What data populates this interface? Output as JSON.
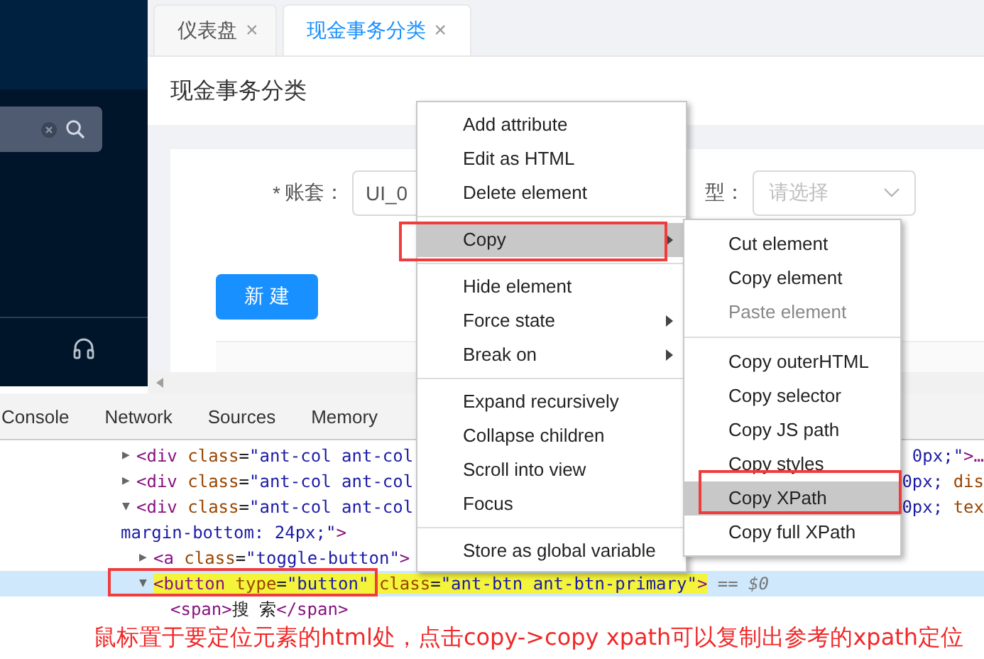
{
  "app": {
    "tabs": [
      {
        "label": "仪表盘",
        "close": "×",
        "selected": false
      },
      {
        "label": "现金事务分类",
        "close": "×",
        "selected": true
      }
    ],
    "page_title": "现金事务分类",
    "form": [
      {
        "required_mark": "*",
        "label": "账套：",
        "value": "UI_0"
      },
      {
        "label": "型：",
        "placeholder": "请选择"
      }
    ],
    "new_button": "新 建"
  },
  "devtools": {
    "tabs": [
      "Console",
      "Network",
      "Sources",
      "Memory"
    ],
    "elements": [
      {
        "toggle": "▶",
        "selected": false,
        "open": [
          {
            "kind": "tag",
            "text": "<div"
          },
          {
            "kind": "attr",
            "text": " class"
          },
          {
            "kind": "plain",
            "text": "="
          },
          {
            "kind": "value",
            "text": "\"ant-col ant-col"
          }
        ],
        "right": [
          {
            "kind": "value",
            "text": "0px;\""
          },
          {
            "kind": "tag",
            "text": ">…"
          }
        ]
      },
      {
        "toggle": "▶",
        "selected": false,
        "open": [
          {
            "kind": "tag",
            "text": "<div"
          },
          {
            "kind": "attr",
            "text": " class"
          },
          {
            "kind": "plain",
            "text": "="
          },
          {
            "kind": "value",
            "text": "\"ant-col ant-col"
          }
        ],
        "right": [
          {
            "kind": "value",
            "text": "0px;"
          },
          {
            "kind": "attr",
            "text": " dis"
          }
        ]
      },
      {
        "toggle": "▼",
        "selected": false,
        "open": [
          {
            "kind": "tag",
            "text": "<div"
          },
          {
            "kind": "attr",
            "text": " class"
          },
          {
            "kind": "plain",
            "text": "="
          },
          {
            "kind": "value",
            "text": "\"ant-col ant-col"
          }
        ],
        "right": [
          {
            "kind": "value",
            "text": "0px;"
          },
          {
            "kind": "attr",
            "text": " tex"
          }
        ],
        "wrap": [
          {
            "kind": "value",
            "text": "margin-bottom: 24px;\""
          },
          {
            "kind": "tag",
            "text": ">"
          }
        ],
        "children": [
          {
            "toggle": "▶",
            "selected": false,
            "open": [
              {
                "kind": "tag",
                "text": "<a"
              },
              {
                "kind": "attr",
                "text": " class"
              },
              {
                "kind": "plain",
                "text": "="
              },
              {
                "kind": "value",
                "text": "\"toggle-button\""
              },
              {
                "kind": "tag",
                "text": ">"
              }
            ]
          },
          {
            "toggle": "▼",
            "selected": true,
            "open": [
              {
                "kind": "tag",
                "text": "<button"
              },
              {
                "kind": "attr",
                "text": " type"
              },
              {
                "kind": "plain",
                "text": "="
              },
              {
                "kind": "value",
                "text": "\"button\""
              },
              {
                "kind": "attr",
                "text": " class"
              },
              {
                "kind": "plain",
                "text": "="
              },
              {
                "kind": "value",
                "text": "\"ant-btn ant-btn-primary\""
              },
              {
                "kind": "tag",
                "text": ">"
              },
              {
                "kind": "comment",
                "text": " == $0"
              }
            ],
            "children": [
              {
                "selected": false,
                "open": [
                  {
                    "kind": "tag",
                    "text": "<span>"
                  },
                  {
                    "kind": "plain",
                    "text": "搜 索"
                  },
                  {
                    "kind": "tag",
                    "text": "</span>"
                  }
                ]
              }
            ]
          }
        ]
      }
    ]
  },
  "context_menu": {
    "items": [
      {
        "kind": "item",
        "label": "Add attribute",
        "selected": false
      },
      {
        "kind": "item",
        "label": "Edit as HTML",
        "selected": false
      },
      {
        "kind": "item",
        "label": "Delete element",
        "selected": false
      },
      {
        "kind": "separator"
      },
      {
        "kind": "submenu",
        "label": "Copy",
        "selected": true
      },
      {
        "kind": "separator"
      },
      {
        "kind": "item",
        "label": "Hide element",
        "selected": false
      },
      {
        "kind": "submenu",
        "label": "Force state",
        "selected": false
      },
      {
        "kind": "submenu",
        "label": "Break on",
        "selected": false
      },
      {
        "kind": "separator"
      },
      {
        "kind": "item",
        "label": "Expand recursively",
        "selected": false
      },
      {
        "kind": "item",
        "label": "Collapse children",
        "selected": false
      },
      {
        "kind": "item",
        "label": "Scroll into view",
        "selected": false
      },
      {
        "kind": "item",
        "label": "Focus",
        "selected": false
      },
      {
        "kind": "separator"
      },
      {
        "kind": "item",
        "label": "Store as global variable",
        "selected": false
      }
    ],
    "submenu": [
      {
        "kind": "item",
        "label": "Cut element",
        "selected": false,
        "disabled": false
      },
      {
        "kind": "item",
        "label": "Copy element",
        "selected": false,
        "disabled": false
      },
      {
        "kind": "item",
        "label": "Paste element",
        "selected": false,
        "disabled": true
      },
      {
        "kind": "separator"
      },
      {
        "kind": "item",
        "label": "Copy outerHTML",
        "selected": false,
        "disabled": false
      },
      {
        "kind": "item",
        "label": "Copy selector",
        "selected": false,
        "disabled": false
      },
      {
        "kind": "item",
        "label": "Copy JS path",
        "selected": false,
        "disabled": false
      },
      {
        "kind": "item",
        "label": "Copy styles",
        "selected": false,
        "disabled": false
      },
      {
        "kind": "item",
        "label": "Copy XPath",
        "selected": true,
        "disabled": false
      },
      {
        "kind": "item",
        "label": "Copy full XPath",
        "selected": false,
        "disabled": false
      }
    ]
  },
  "annotation": "鼠标置于要定位元素的html处，点击copy->copy xpath可以复制出参考的xpath定位"
}
